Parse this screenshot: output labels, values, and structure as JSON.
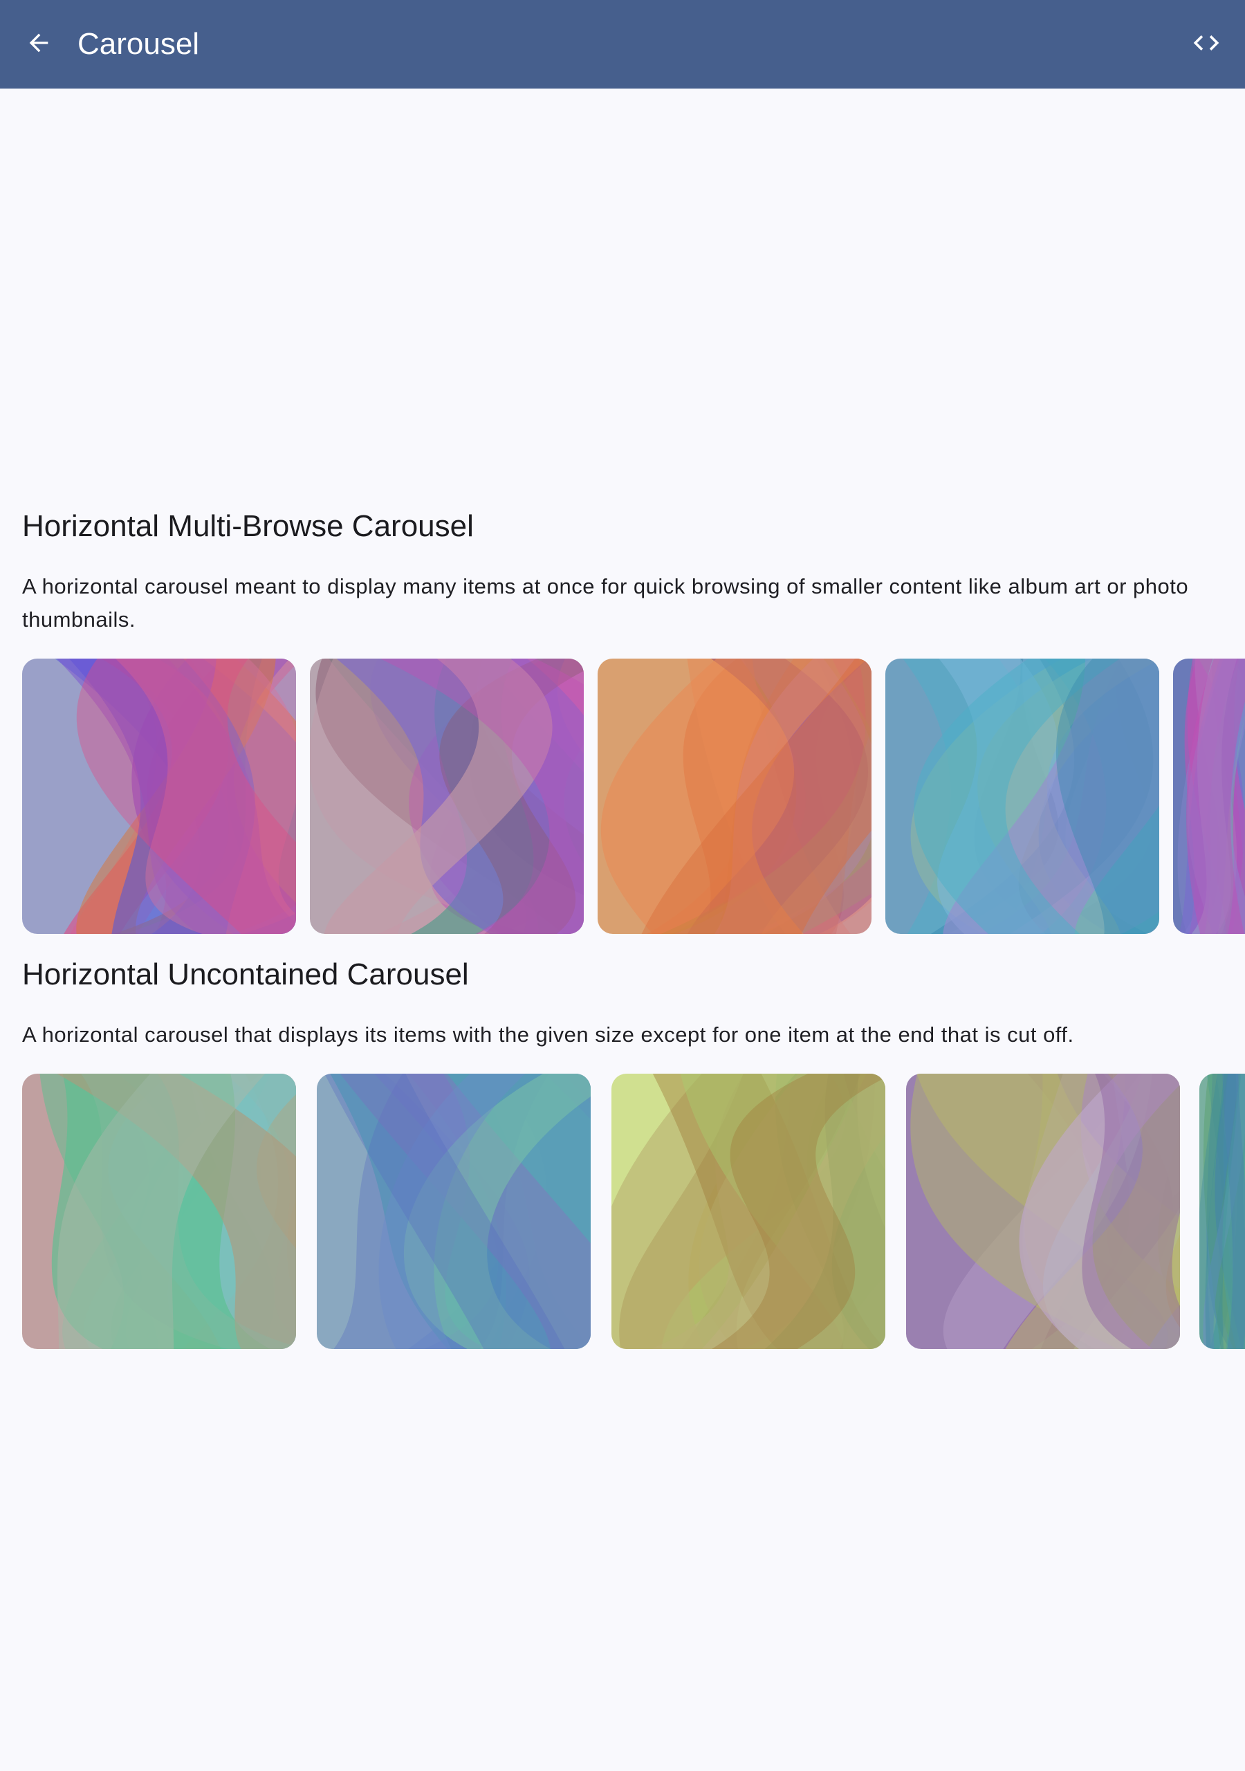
{
  "appbar": {
    "title": "Carousel",
    "back_icon": "arrow-back-icon",
    "code_icon": "code-icon",
    "background": "#465f8d"
  },
  "sections": [
    {
      "title": "Horizontal Multi-Browse Carousel",
      "description": "A horizontal carousel meant to display many items at once for quick browsing of smaller content like album art or photo thumbnails.",
      "items": [
        {
          "palette": [
            "#d9739a",
            "#e04a84",
            "#d9783a",
            "#4a5ae0",
            "#7a4bd0",
            "#9aa0c8"
          ]
        },
        {
          "palette": [
            "#c49aa8",
            "#c24fb4",
            "#4f9b8a",
            "#7a68d0",
            "#8a5a70",
            "#b7a5b0"
          ]
        },
        {
          "palette": [
            "#e88a55",
            "#d96e3a",
            "#8a3a6a",
            "#9aa040",
            "#b67ad0",
            "#d9a070"
          ]
        },
        {
          "palette": [
            "#4bb0c8",
            "#3a8ab0",
            "#7ab6d8",
            "#8fb8a0",
            "#9a8ad0",
            "#6fa0c0"
          ]
        },
        {
          "palette": [
            "#8a88d0",
            "#c24fb4",
            "#5ac0a0",
            "#7a68d0",
            "#9aa0c8",
            "#6a7ab8"
          ]
        }
      ]
    },
    {
      "title": "Horizontal Uncontained Carousel",
      "description": "A horizontal carousel that displays its items with the given size except for one item at the end that is cut off.",
      "items": [
        {
          "palette": [
            "#a8b8a8",
            "#8ab8a0",
            "#6ac8d8",
            "#5ac090",
            "#b09a7a",
            "#c0a0a0"
          ]
        },
        {
          "palette": [
            "#6a8ac8",
            "#5a70c0",
            "#4aa8b0",
            "#8a70c0",
            "#7ac0a8",
            "#8aa8c0"
          ]
        },
        {
          "palette": [
            "#b8b070",
            "#a07a3a",
            "#a8d070",
            "#c0b080",
            "#90a060",
            "#d0e090"
          ]
        },
        {
          "palette": [
            "#c0a8d0",
            "#8a5aa0",
            "#b0b070",
            "#a8c0b8",
            "#c0c060",
            "#9a80b0"
          ]
        },
        {
          "palette": [
            "#4aa0a0",
            "#4a80b0",
            "#5aa070",
            "#6a90c0",
            "#3a8a9a",
            "#7ab0a0"
          ]
        }
      ]
    }
  ]
}
